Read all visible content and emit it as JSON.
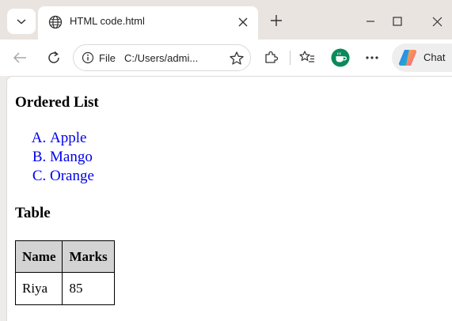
{
  "browser": {
    "tab": {
      "title": "HTML code.html"
    },
    "address_bar": {
      "scheme_label": "File",
      "url": "C:/Users/admi..."
    },
    "copilot": {
      "label": "Chat"
    },
    "icons": [
      "tab-actions-chevron-icon",
      "globe-icon",
      "close-icon",
      "plus-icon",
      "minimize-icon",
      "maximize-icon",
      "window-close-icon",
      "back-arrow-icon",
      "reload-icon",
      "info-icon",
      "star-icon",
      "extensions-puzzle-icon",
      "favorites-icon",
      "profile-avatar-icon",
      "more-dots-icon",
      "copilot-icon"
    ]
  },
  "page": {
    "list_heading": "Ordered List",
    "list_items": [
      "Apple",
      "Mango",
      "Orange"
    ],
    "table_heading": "Table",
    "table": {
      "headers": [
        "Name",
        "Marks"
      ],
      "rows": [
        [
          "Riya",
          "85"
        ]
      ]
    }
  },
  "colors": {
    "link_blue": "#0000ee",
    "table_header_bg": "#d3d3d3",
    "tabstrip_bg": "#e9e4e0"
  }
}
